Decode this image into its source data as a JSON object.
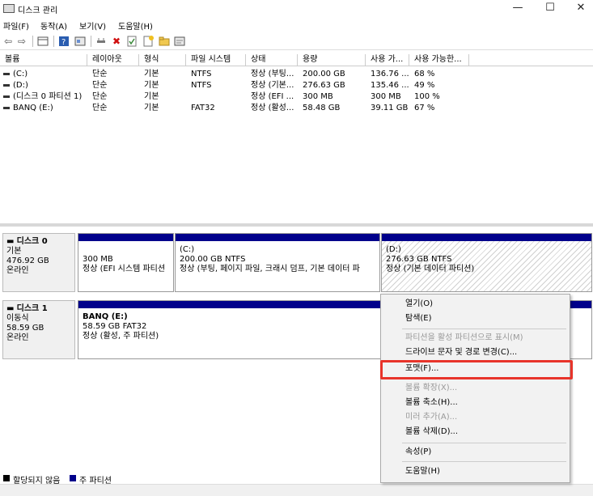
{
  "window": {
    "title": "디스크 관리",
    "minimize": "—",
    "maximize": "☐",
    "close": "✕"
  },
  "menu": [
    "파일(F)",
    "동작(A)",
    "보기(V)",
    "도움말(H)"
  ],
  "toolbar_icons": [
    "back-icon",
    "forward-icon",
    "volume-list-icon",
    "help-icon",
    "properties-icon",
    "connect-icon",
    "delete-icon",
    "check-icon",
    "new-icon",
    "folder-icon",
    "rescan-icon"
  ],
  "volume_columns": [
    "볼륨",
    "레이아웃",
    "형식",
    "파일 시스템",
    "상태",
    "용량",
    "사용 가...",
    "사용 가능한..."
  ],
  "volumes": [
    {
      "name": "(C:)",
      "layout": "단순",
      "type": "기본",
      "fs": "NTFS",
      "status": "정상 (부팅...",
      "capacity": "200.00 GB",
      "free": "136.76 ...",
      "pct": "68 %"
    },
    {
      "name": "(D:)",
      "layout": "단순",
      "type": "기본",
      "fs": "NTFS",
      "status": "정상 (기본...",
      "capacity": "276.63 GB",
      "free": "135.46 ...",
      "pct": "49 %"
    },
    {
      "name": "(디스크 0 파티션 1)",
      "layout": "단순",
      "type": "기본",
      "fs": "",
      "status": "정상 (EFI ...",
      "capacity": "300 MB",
      "free": "300 MB",
      "pct": "100 %"
    },
    {
      "name": "BANQ (E:)",
      "layout": "단순",
      "type": "기본",
      "fs": "FAT32",
      "status": "정상 (활성...",
      "capacity": "58.48 GB",
      "free": "39.11 GB",
      "pct": "67 %"
    }
  ],
  "disks": [
    {
      "name": "디스크 0",
      "type": "기본",
      "size": "476.92 GB",
      "state": "온라인",
      "partitions": [
        {
          "title": "",
          "size": "300 MB",
          "status": "정상 (EFI 시스템 파티션"
        },
        {
          "title": "(C:)",
          "size": "200.00 GB NTFS",
          "status": "정상 (부팅, 페이지 파일, 크래시 덤프, 기본 데이터 파"
        },
        {
          "title": "(D:)",
          "size": "276.63 GB NTFS",
          "status": "정상 (기본 데이터 파티션)"
        }
      ]
    },
    {
      "name": "디스크 1",
      "type": "이동식",
      "size": "58.59 GB",
      "state": "온라인",
      "partitions": [
        {
          "title": "BANQ  (E:)",
          "size": "58.59 GB FAT32",
          "status": "정상 (활성, 주 파티션)"
        }
      ]
    }
  ],
  "context_menu": [
    {
      "label": "열기(O)",
      "enabled": true
    },
    {
      "label": "탐색(E)",
      "enabled": true
    },
    {
      "label": "파티션을 활성 파티션으로 표시(M)",
      "enabled": false
    },
    {
      "label": "드라이브 문자 및 경로 변경(C)...",
      "enabled": true
    },
    {
      "label": "포맷(F)...",
      "enabled": true
    },
    {
      "label": "볼륨 확장(X)...",
      "enabled": false
    },
    {
      "label": "볼륨 축소(H)...",
      "enabled": true
    },
    {
      "label": "미러 추가(A)...",
      "enabled": false
    },
    {
      "label": "볼륨 삭제(D)...",
      "enabled": true
    },
    {
      "label": "속성(P)",
      "enabled": true
    },
    {
      "label": "도움말(H)",
      "enabled": true
    }
  ],
  "legend": [
    {
      "label": "할당되지 않음",
      "color": "#000000"
    },
    {
      "label": "주 파티션",
      "color": "#00008b"
    }
  ],
  "colors": {
    "primary_partition": "#00008b",
    "highlight": "#e8342a"
  }
}
